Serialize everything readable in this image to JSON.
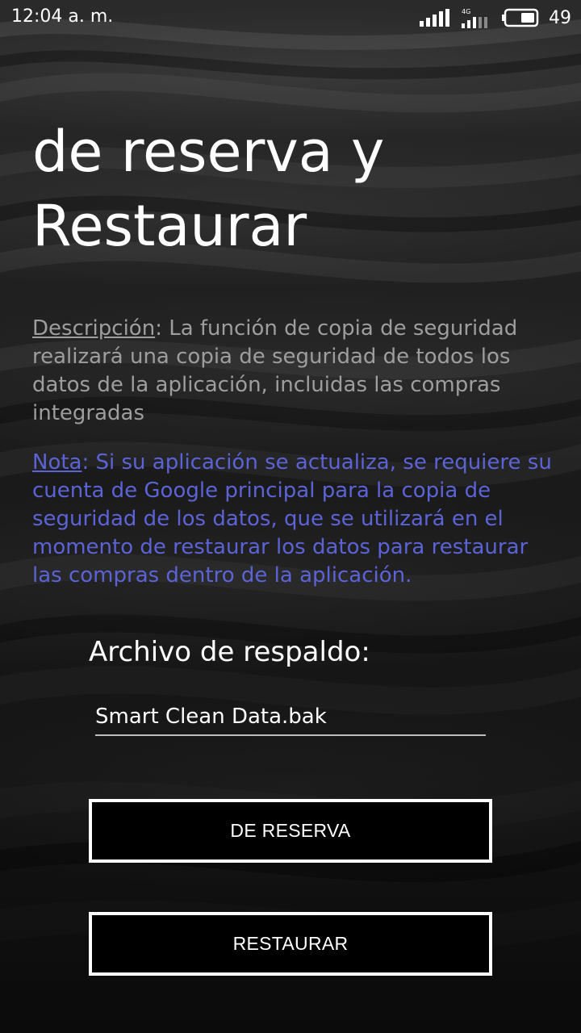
{
  "status_bar": {
    "time": "12:04 a. m.",
    "network_label": "4G",
    "battery_percent": "49",
    "icons": [
      "signal-icon",
      "network-4g-icon",
      "battery-icon"
    ]
  },
  "title": {
    "line1": "de reserva y",
    "line2": "Restaurar"
  },
  "description": {
    "label": "Descripción",
    "text": ": La función de copia de seguridad realizará una copia de seguridad de todos los datos de la aplicación, incluidas las compras integradas"
  },
  "note": {
    "label": "Nota",
    "text": ": Si su aplicación se actualiza, se requiere su cuenta de Google principal para la copia de seguridad de los datos, que se utilizará en el momento de restaurar los datos para restaurar las compras dentro de la aplicación."
  },
  "backup_file": {
    "label": "Archivo de respaldo:",
    "value": "Smart Clean Data.bak"
  },
  "buttons": {
    "backup": "DE RESERVA",
    "restore": "RESTAURAR"
  },
  "colors": {
    "description_text": "#9e9e9e",
    "note_text": "#5b63d6",
    "button_border": "#ffffff",
    "button_bg": "#000000"
  }
}
